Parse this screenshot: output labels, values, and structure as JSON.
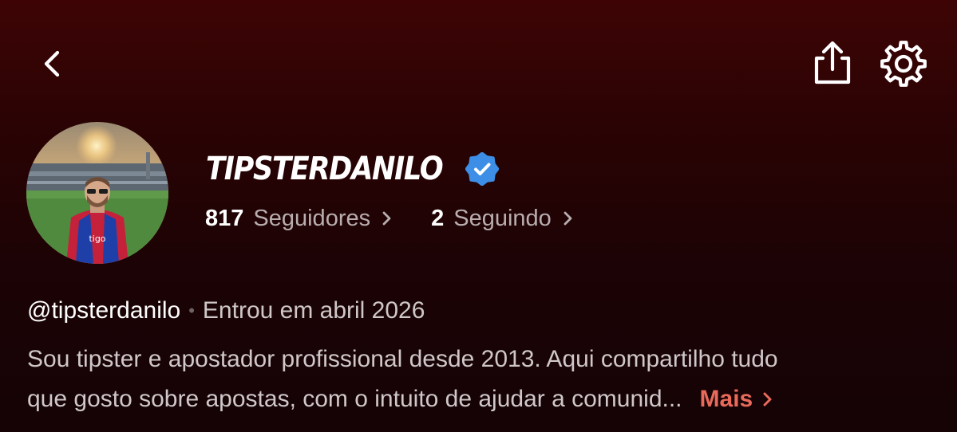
{
  "header": {
    "back_icon": "chevron-left-icon",
    "share_icon": "share-icon",
    "settings_icon": "gear-icon"
  },
  "profile": {
    "display_name": "TIPSTERDANILO",
    "verified": true,
    "verified_color": "#3d8ee6",
    "avatar_icon": "profile-photo-stadium",
    "followers": {
      "count": "817",
      "label": "Seguidores"
    },
    "following": {
      "count": "2",
      "label": "Seguindo"
    },
    "handle": "@tipsterdanilo",
    "separator": "•",
    "joined": "Entrou em abril 2026",
    "bio_line_1": "Sou tipster e apostador profissional desde 2013. Aqui compartilho tudo",
    "bio_line_2": "que gosto sobre apostas, com o intuito de ajudar a comunid...",
    "more_label": "Mais"
  },
  "colors": {
    "background_top": "#3e0405",
    "background_bottom": "#150306",
    "accent": "#e96a5b",
    "muted_text": "#b9aeaf"
  }
}
